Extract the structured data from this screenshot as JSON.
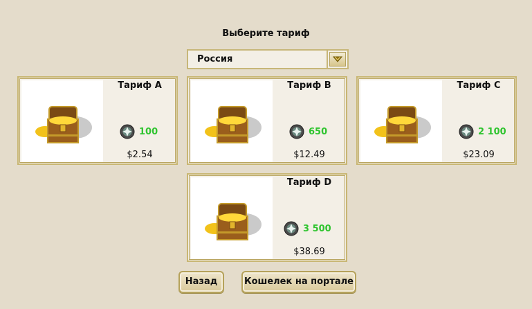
{
  "header": {
    "title": "Выберите тариф"
  },
  "country_select": {
    "selected": "Россия"
  },
  "tariffs": [
    {
      "name": "Тариф A",
      "coins": "100",
      "price": "$2.54"
    },
    {
      "name": "Тариф B",
      "coins": "650",
      "price": "$12.49"
    },
    {
      "name": "Тариф C",
      "coins": "2 100",
      "price": "$23.09"
    },
    {
      "name": "Тариф D",
      "coins": "3 500",
      "price": "$38.69"
    }
  ],
  "buttons": {
    "back": "Назад",
    "wallet": "Кошелек на портале"
  },
  "colors": {
    "background": "#e4dccb",
    "coin_text": "#2fc42f",
    "border": "#c8b673"
  },
  "icons": {
    "card_image": "treasure-chest-icon",
    "currency": "gem-coin-icon",
    "dropdown": "chevron-down-icon"
  }
}
